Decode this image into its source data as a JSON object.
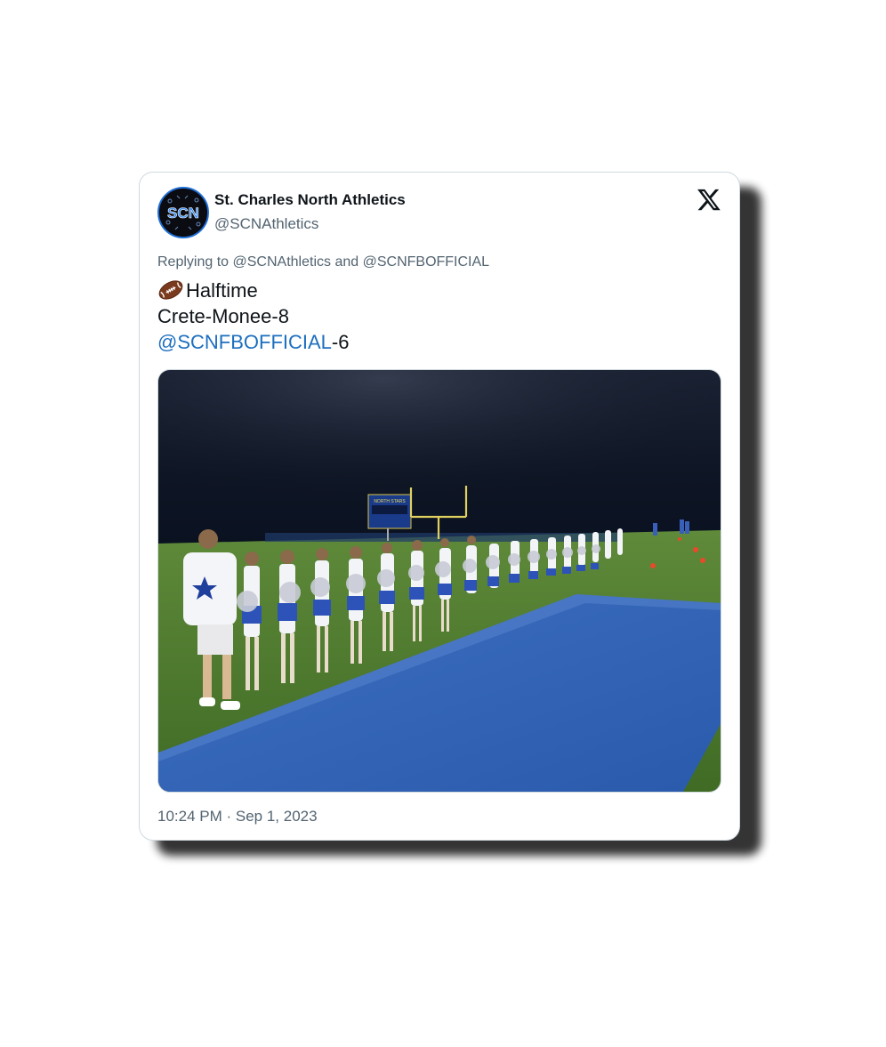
{
  "author": {
    "name": "St. Charles North Athletics",
    "handle": "@SCNAthletics",
    "avatar_text": "SCN"
  },
  "reply": {
    "prefix": "Replying to ",
    "mention1": "@SCNAthletics",
    "joiner": " and ",
    "mention2": "@SCNFBOFFICIAL"
  },
  "tweet": {
    "line1": "Halftime",
    "line2": "Crete-Monee-8",
    "line3_mention": "@SCNFBOFFICIAL",
    "line3_suffix": "-6",
    "emoji_icon": "american-football-icon"
  },
  "media": {
    "scoreboard_text": "NORTH STARS"
  },
  "timestamp": "10:24 PM · Sep 1, 2023",
  "colors": {
    "link": "#1d6fbf",
    "text": "#0f1419",
    "muted": "#536471"
  }
}
